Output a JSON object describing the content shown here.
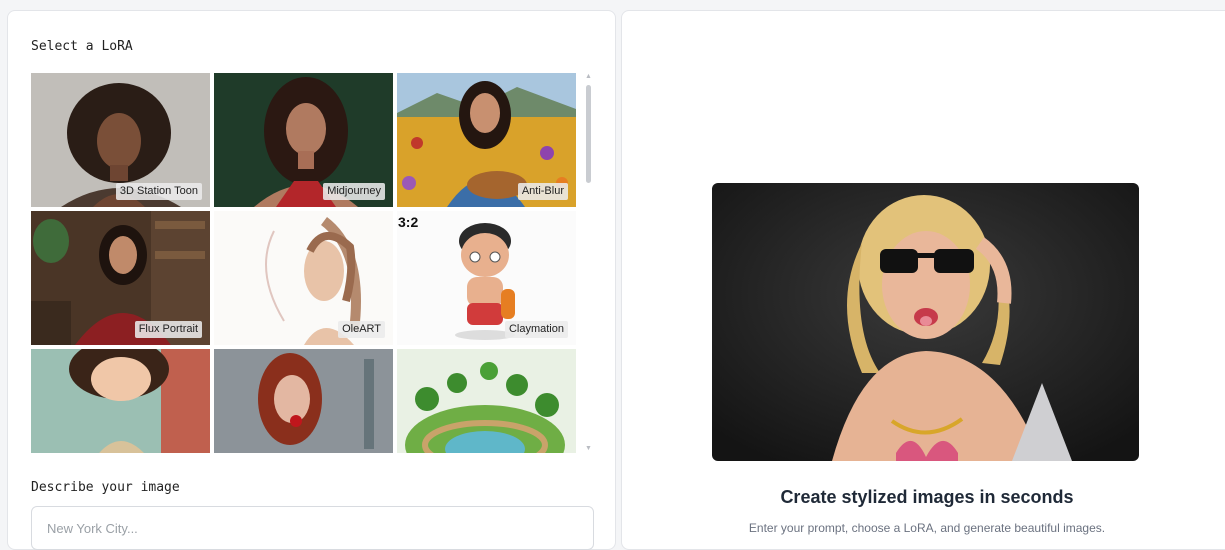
{
  "lora_section": {
    "label": "Select a LoRA",
    "items": [
      {
        "label": "3D Station Toon"
      },
      {
        "label": "Midjourney"
      },
      {
        "label": "Anti-Blur"
      },
      {
        "label": "Flux Portrait"
      },
      {
        "label": "OleART"
      },
      {
        "label": "Claymation",
        "badge": "3:2"
      },
      {
        "label": ""
      },
      {
        "label": ""
      },
      {
        "label": ""
      }
    ]
  },
  "prompt_section": {
    "label": "Describe your image",
    "placeholder": "New York City..."
  },
  "hero": {
    "title": "Create stylized images in seconds",
    "subtitle": "Enter your prompt, choose a LoRA, and generate beautiful images."
  }
}
